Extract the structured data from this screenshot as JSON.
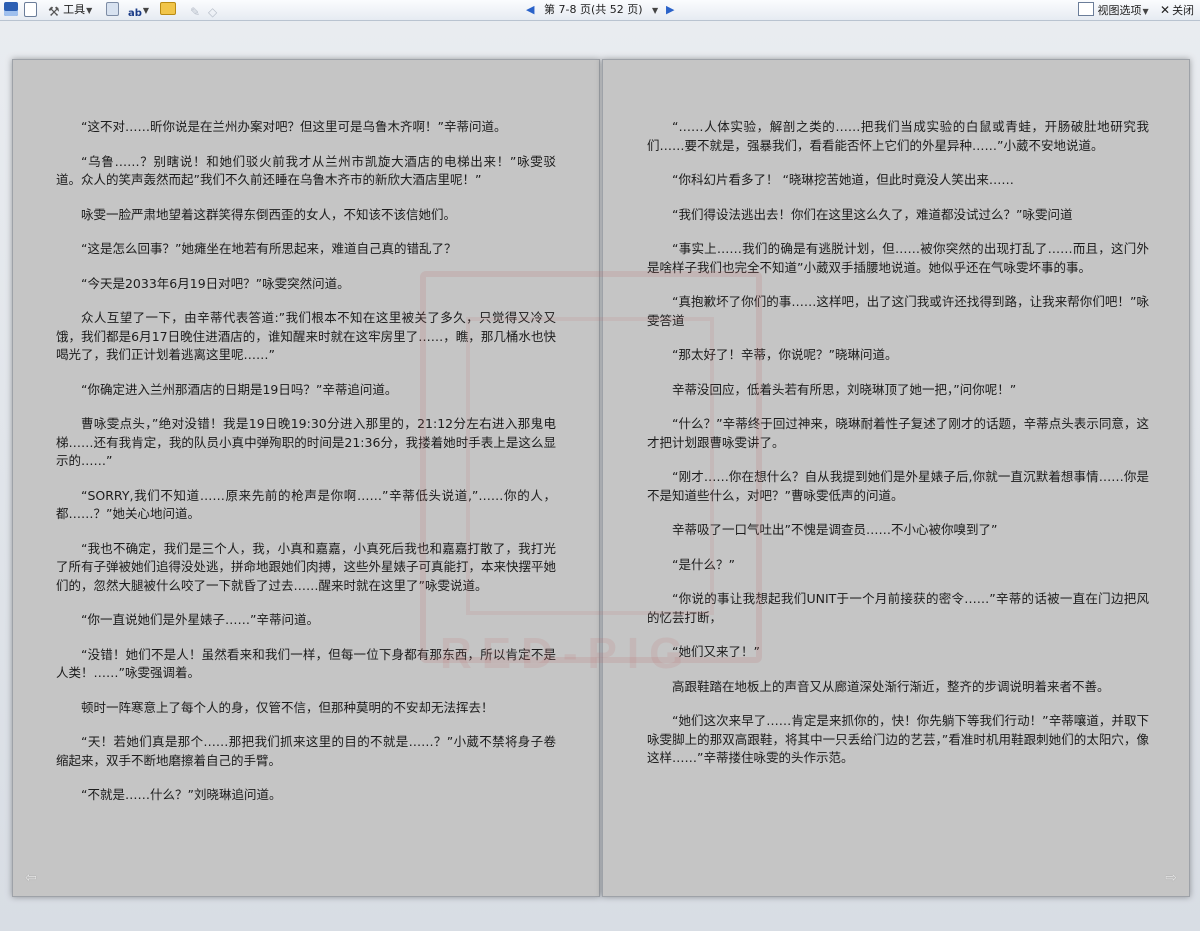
{
  "toolbar": {
    "tools_label": "工具",
    "page_info": "第 7-8 页(共 52 页)",
    "view_options_label": "视图选项",
    "close_label": "关闭"
  },
  "watermark": {
    "text": "RED-PIG"
  },
  "left_page": {
    "paragraphs": [
      "“这不对……昕你说是在兰州办案对吧？但这里可是乌鲁木齐啊！”辛蒂问道。",
      "“乌鲁……？别瞎说！和她们驳火前我才从兰州市凯旋大酒店的电梯出来！”咏雯驳道。众人的笑声轰然而起”我们不久前还睡在乌鲁木齐市的新欣大酒店里呢！”",
      "咏雯一脸严肃地望着这群笑得东倒西歪的女人，不知该不该信她们。",
      "“这是怎么回事？”她瘫坐在地若有所思起来，难道自己真的错乱了？",
      "“今天是2033年6月19日对吧？”咏雯突然问道。",
      "众人互望了一下，由辛蒂代表答道:”我们根本不知在这里被关了多久，只觉得又冷又饿，我们都是6月17日晚住进酒店的，谁知醒来时就在这牢房里了……，瞧，那几桶水也快喝光了，我们正计划着逃离这里呢……”",
      "“你确定进入兰州那酒店的日期是19日吗？”辛蒂追问道。",
      "曹咏雯点头，”绝对没错！我是19日晚19:30分进入那里的，21:12分左右进入那鬼电梯……还有我肯定，我的队员小真中弹殉职的时间是21:36分，我搂着她时手表上是这么显示的……”",
      "“SORRY,我们不知道……原来先前的枪声是你啊……”辛蒂低头说道,”……你的人，都……？”她关心地问道。",
      "“我也不确定，我们是三个人，我，小真和嘉嘉，小真死后我也和嘉嘉打散了，我打光了所有子弹被她们追得没处逃，拼命地跟她们肉搏，这些外星婊子可真能打，本来快摆平她们的，忽然大腿被什么咬了一下就昏了过去……醒来时就在这里了”咏雯说道。",
      "“你一直说她们是外星婊子……”辛蒂问道。",
      "“没错！她们不是人！虽然看来和我们一样，但每一位下身都有那东西，所以肯定不是人类！……”咏雯强调着。",
      "顿时一阵寒意上了每个人的身，仅管不信，但那种莫明的不安却无法挥去！",
      "“天！若她们真是那个……那把我们抓来这里的目的不就是……？”小葳不禁将身子卷缩起来，双手不断地磨擦着自己的手臂。",
      "“不就是……什么？”刘晓琳追问道。"
    ]
  },
  "right_page": {
    "paragraphs": [
      "“……人体实验，解剖之类的……把我们当成实验的白鼠或青蛙，开肠破肚地研究我们……要不就是，强暴我们，看看能否怀上它们的外星异种……”小葳不安地说道。",
      "“你科幻片看多了！ “晓琳挖苦她道，但此时竟没人笑出来……",
      "“我们得设法逃出去！你们在这里这么久了，难道都没试过么？”咏雯问道",
      "“事实上……我们的确是有逃脱计划，但……被你突然的出现打乱了……而且，这门外是啥样子我们也完全不知道”小葳双手插腰地说道。她似乎还在气咏雯坏事的事。",
      "“真抱歉坏了你们的事……这样吧，出了这门我或许还找得到路，让我来帮你们吧！”咏雯答道",
      "“那太好了！辛蒂，你说呢？”晓琳问道。",
      "辛蒂没回应，低着头若有所思，刘晓琳顶了她一把，”问你呢！”",
      "“什么？”辛蒂终于回过神来，晓琳耐着性子复述了刚才的话题，辛蒂点头表示同意，这才把计划跟曹咏雯讲了。",
      "“刚才……你在想什么？自从我提到她们是外星婊子后,你就一直沉默着想事情……你是不是知道些什么，对吧？”曹咏雯低声的问道。",
      "辛蒂吸了一口气吐出”不愧是调查员……不小心被你嗅到了”",
      "“是什么？”",
      "“你说的事让我想起我们UNIT于一个月前接获的密令……”辛蒂的话被一直在门边把风的忆芸打断，",
      "“她们又来了！”",
      "高跟鞋踏在地板上的声音又从廊道深处渐行渐近，整齐的步调说明着来者不善。",
      "“她们这次来早了……肯定是来抓你的，快！你先躺下等我们行动！”辛蒂嚷道，并取下咏雯脚上的那双高跟鞋，将其中一只丢给门边的艺芸，”看准时机用鞋跟刺她们的太阳穴，像这样……”辛蒂搂住咏雯的头作示范。"
    ]
  }
}
